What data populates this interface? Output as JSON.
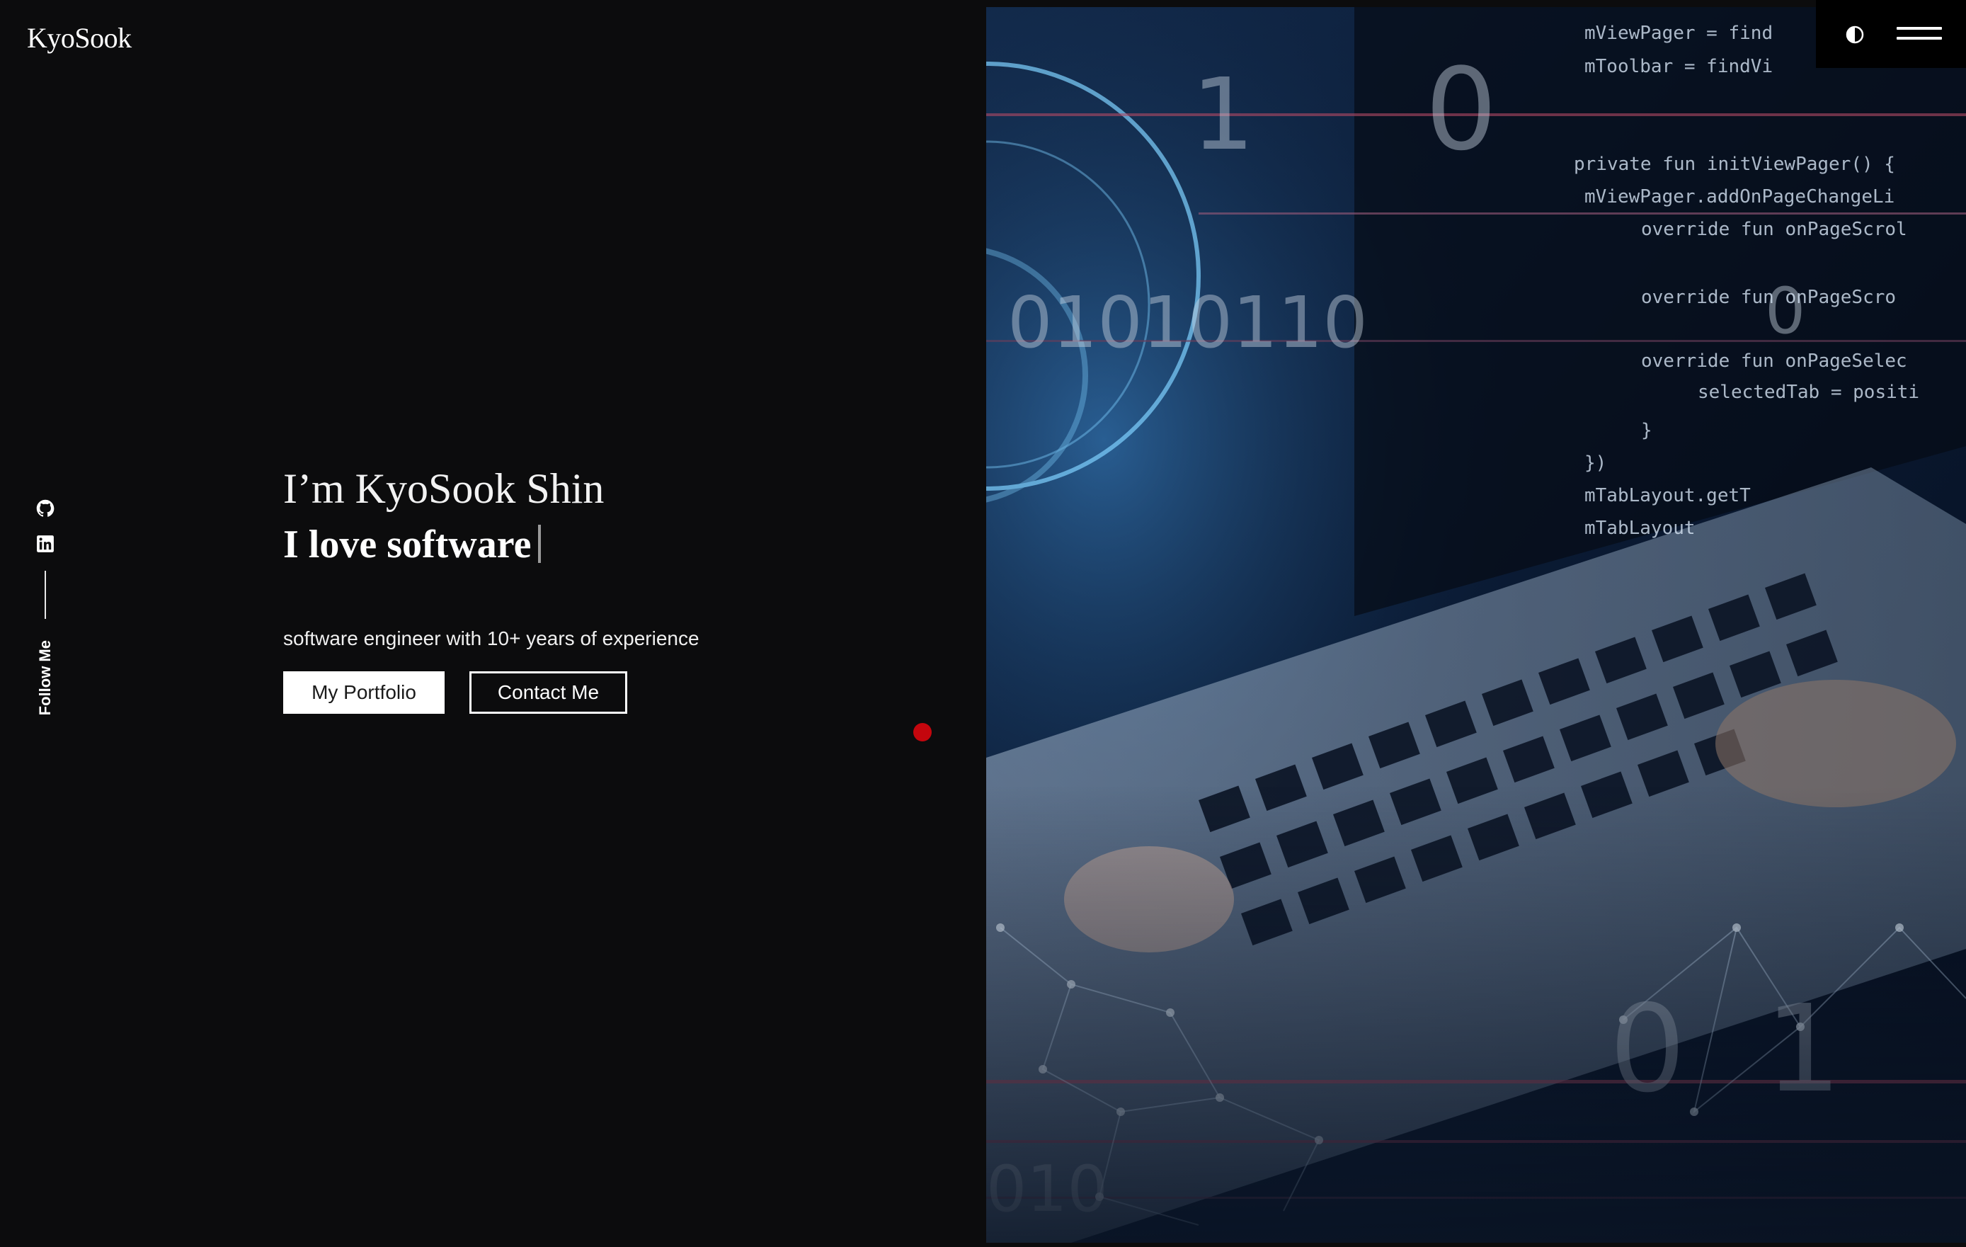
{
  "logo": {
    "text": "KyoSook"
  },
  "social": {
    "items": [
      {
        "name": "GitHub",
        "icon": "github-icon"
      },
      {
        "name": "LinkedIn",
        "icon": "linkedin-icon"
      }
    ],
    "follow_label": "Follow Me"
  },
  "hero": {
    "greeting": "I’m KyoSook Shin",
    "typed_text": "I love software",
    "tagline": "software engineer with 10+ years of experience",
    "primary_button": "My Portfolio",
    "secondary_button": "Contact Me"
  },
  "header": {
    "theme_toggle_icon": "contrast-icon",
    "menu_icon": "hamburger-menu-icon"
  },
  "hero_image": {
    "overlay_numbers": [
      "1",
      "0",
      "01010110",
      "0",
      "0",
      "1",
      "010"
    ],
    "code_lines": [
      "mViewPager = find",
      "mToolbar = findVi",
      "private fun initViewPager() {",
      "mViewPager.addOnPageChangeLi",
      "override fun onPageScrol",
      "override fun onPageScro",
      "override fun onPageSelec",
      "selectedTab = positi",
      "}",
      "})",
      "mTabLayout.getT",
      "mTabLayout"
    ]
  },
  "colors": {
    "background": "#0c0c0d",
    "accent_dot": "#c4060d",
    "text": "#ffffff"
  }
}
